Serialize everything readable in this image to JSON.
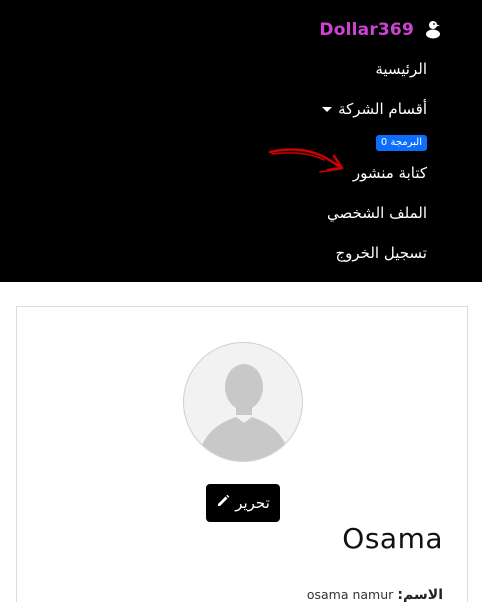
{
  "brand": {
    "name": "Dollar369",
    "icon": "duck-icon"
  },
  "nav": {
    "home_label": "الرئيسية",
    "departments_label": "أقسام الشركة",
    "badge_label": "البرمجة 0",
    "write_post_label": "كتابة منشور",
    "profile_label": "الملف الشخصي",
    "logout_label": "تسجيل الخروج"
  },
  "profile": {
    "edit_label": "تحرير",
    "edit_icon": "pencil-icon",
    "display_name": "Osama",
    "name_field_label": "الاسم:",
    "name_field_value": "osama namur"
  },
  "colors": {
    "nav_bg": "#000000",
    "brand": "#cf43d3",
    "badge": "#0d6efd",
    "arrow": "#d00000"
  }
}
